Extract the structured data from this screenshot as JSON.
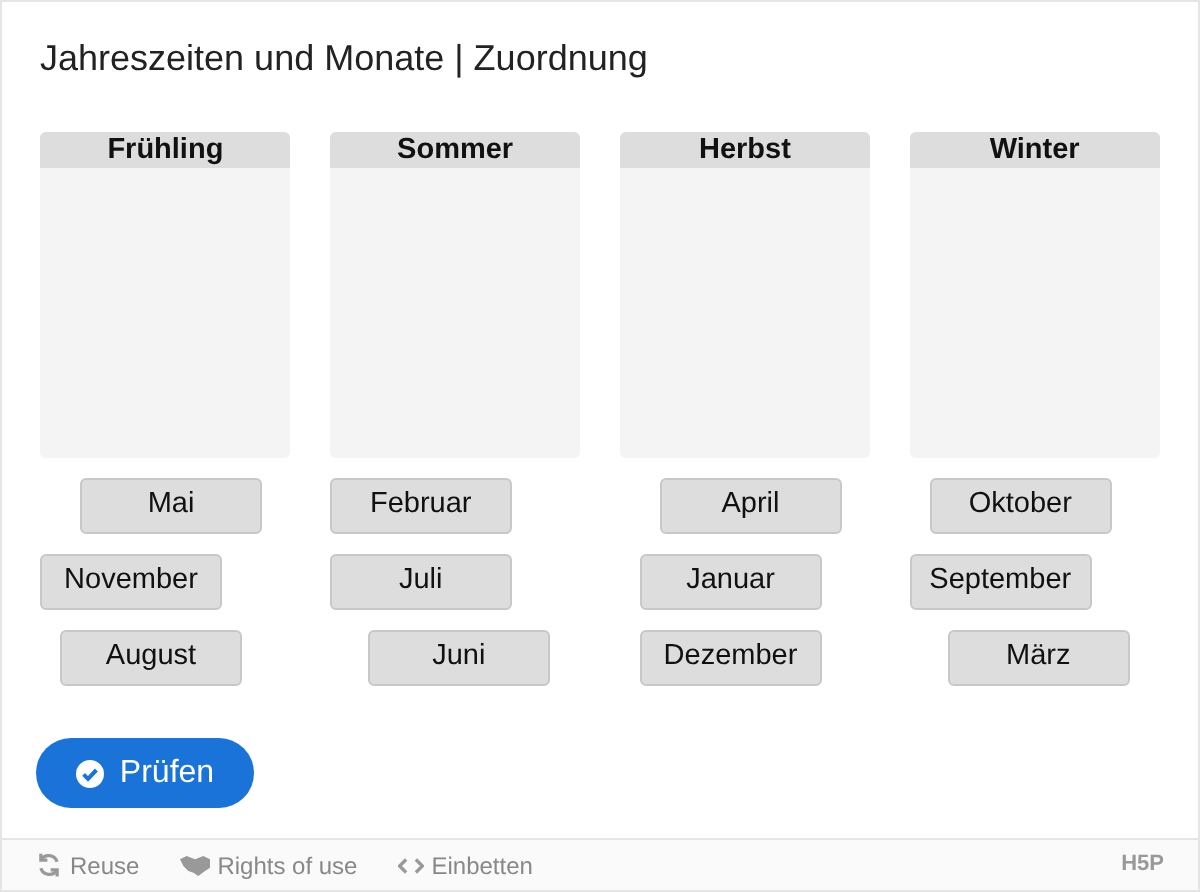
{
  "title": "Jahreszeiten und Monate | Zuordnung",
  "dropzones": [
    {
      "label": "Frühling"
    },
    {
      "label": "Sommer"
    },
    {
      "label": "Herbst"
    },
    {
      "label": "Winter"
    }
  ],
  "draggable_rows": [
    [
      "Mai",
      "Februar",
      "April",
      "Oktober"
    ],
    [
      "November",
      "Juli",
      "Januar",
      "September"
    ],
    [
      "August",
      "Juni",
      "Dezember",
      "März"
    ]
  ],
  "check_button": "Prüfen",
  "footer": {
    "links": [
      {
        "kind": "reuse",
        "label": "Reuse"
      },
      {
        "kind": "rights",
        "label": "Rights of use"
      },
      {
        "kind": "embed",
        "label": "Einbetten"
      }
    ],
    "logo": "H5P"
  }
}
